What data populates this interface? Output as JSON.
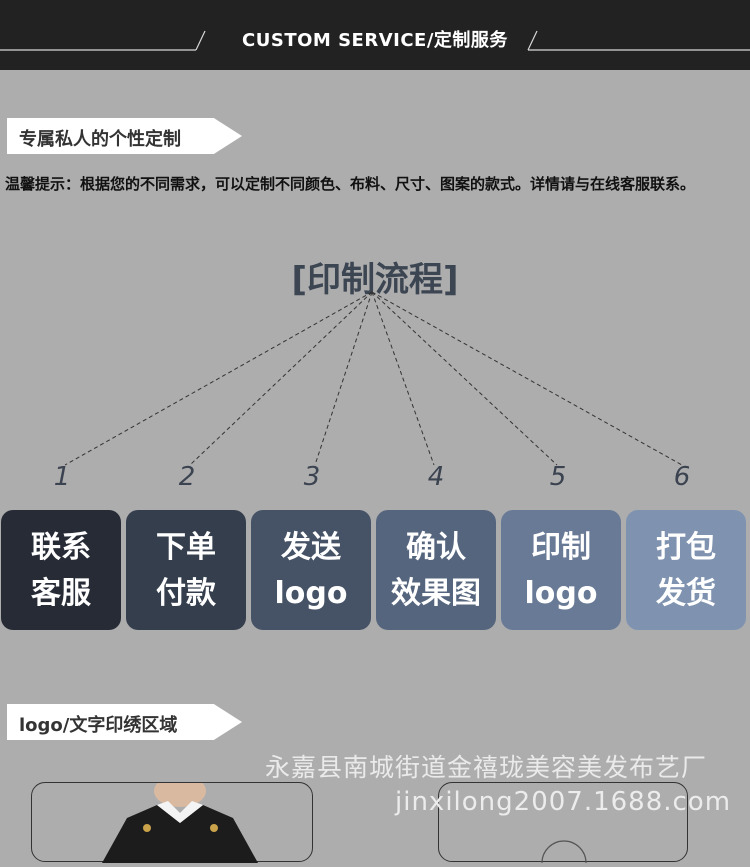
{
  "header": {
    "title": "CUSTOM SERVICE/定制服务"
  },
  "section1": {
    "tag_label": "专属私人的个性定制",
    "tip": "温馨提示：根据您的不同需求，可以定制不同颜色、布料、尺寸、图案的款式。详情请与在线客服联系。"
  },
  "flow": {
    "title": "[印制流程]",
    "steps": [
      {
        "number": "1",
        "line1": "联系",
        "line2": "客服",
        "color": "#262b35"
      },
      {
        "number": "2",
        "line1": "下单",
        "line2": "付款",
        "color": "#353e4d"
      },
      {
        "number": "3",
        "line1": "发送",
        "line2": "logo",
        "color": "#465266"
      },
      {
        "number": "4",
        "line1": "确认",
        "line2": "效果图",
        "color": "#56657e"
      },
      {
        "number": "5",
        "line1": "印制",
        "line2": "logo",
        "color": "#687a96"
      },
      {
        "number": "6",
        "line1": "打包",
        "line2": "发货",
        "color": "#7f93b0"
      }
    ]
  },
  "section2": {
    "tag_label": "logo/文字印绣区域"
  },
  "watermark": {
    "line1": "永嘉县南城街道金禧珑美容美发布艺厂",
    "line2": "jinxilong2007.1688.com"
  }
}
